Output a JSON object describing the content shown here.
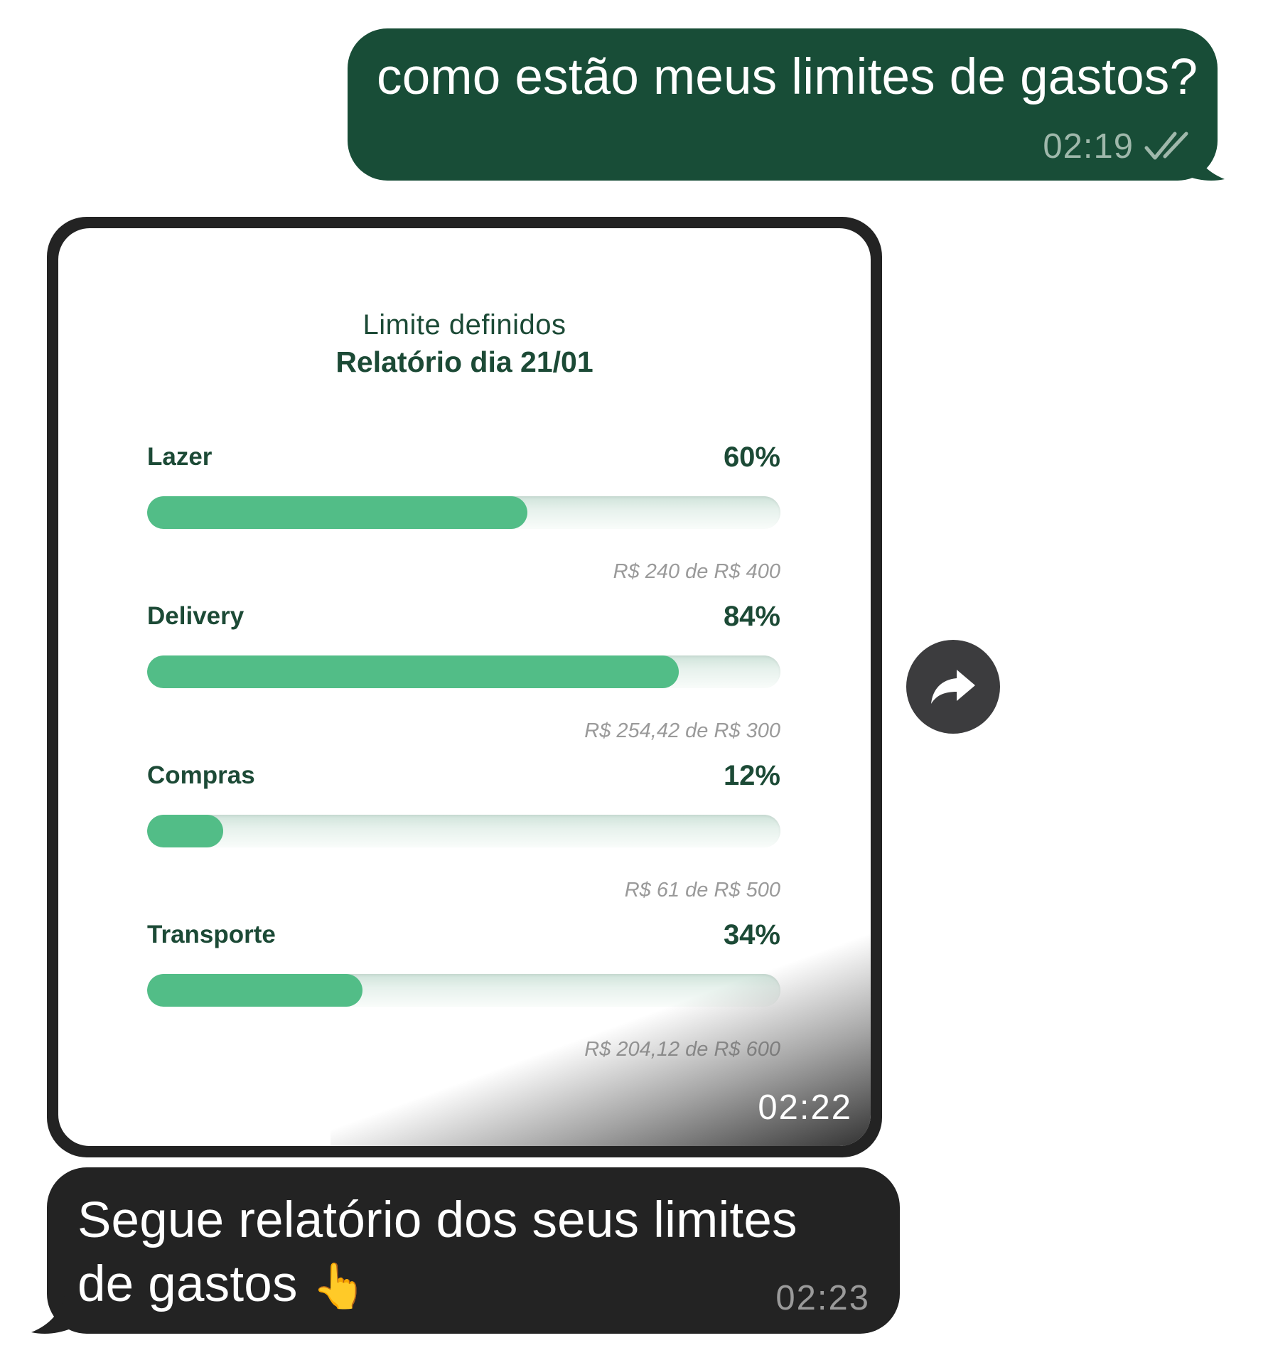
{
  "outgoing_message": {
    "text": "como estão meus limites de gastos?",
    "time": "02:19",
    "status_icon": "double-check-icon"
  },
  "image_message": {
    "time": "02:22",
    "report": {
      "subtitle": "Limite definidos",
      "title": "Relatório dia 21/01",
      "limits": [
        {
          "label": "Lazer",
          "percent_label": "60%",
          "percent": 60,
          "amount": "R$ 240 de R$ 400"
        },
        {
          "label": "Delivery",
          "percent_label": "84%",
          "percent": 84,
          "amount": "R$ 254,42 de R$ 300"
        },
        {
          "label": "Compras",
          "percent_label": "12%",
          "percent": 12,
          "amount": "R$ 61 de R$ 500"
        },
        {
          "label": "Transporte",
          "percent_label": "34%",
          "percent": 34,
          "amount": "R$ 204,12 de R$ 600"
        }
      ]
    }
  },
  "forward_button": {
    "icon": "share-arrow-icon"
  },
  "incoming_message": {
    "text": "Segue relatório dos seus limites de gastos",
    "emoji": "👆",
    "time": "02:23"
  },
  "colors": {
    "outgoing_bubble": "#184d37",
    "incoming_bubble": "#232323",
    "bar_fill": "#52bd87",
    "report_text": "#1c4a36"
  }
}
